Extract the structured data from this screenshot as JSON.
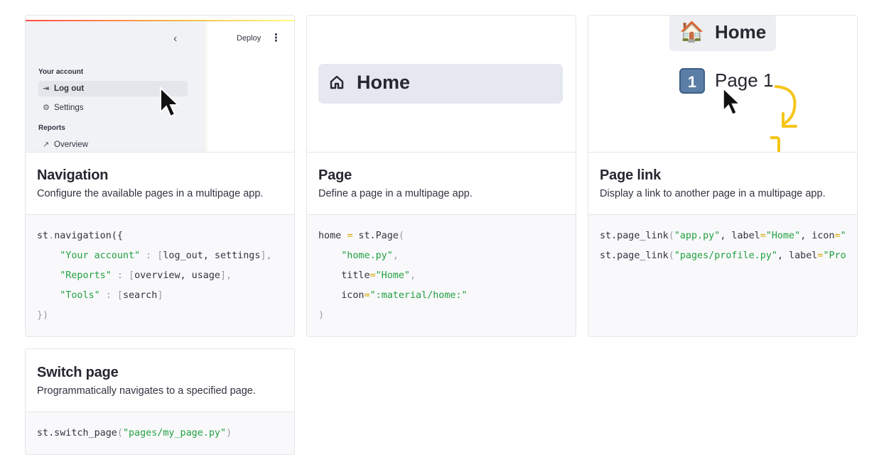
{
  "cards": {
    "navigation": {
      "title": "Navigation",
      "description": "Configure the available pages in a multipage app.",
      "preview": {
        "deploy_label": "Deploy",
        "section_account": "Your account",
        "item_logout": "Log out",
        "item_settings": "Settings",
        "section_reports": "Reports",
        "item_overview": "Overview"
      },
      "code": {
        "l1_a": "st",
        "l1_b": ".",
        "l1_c": "navigation({",
        "l2_key": "\"Your account\"",
        "l2_sep": " : [",
        "l2_val": "log_out, settings",
        "l2_end": "],",
        "l3_key": "\"Reports\"",
        "l3_sep": " : [",
        "l3_val": "overview, usage",
        "l3_end": "],",
        "l4_key": "\"Tools\"",
        "l4_sep": " : [",
        "l4_val": "search",
        "l4_end": "]",
        "l5": "})"
      }
    },
    "page": {
      "title": "Page",
      "description": "Define a page in a multipage app.",
      "preview": {
        "home_label": "Home"
      },
      "code": {
        "l1_a": "home ",
        "l1_eq": "=",
        "l1_b": " st.Page",
        "l1_paren": "(",
        "l2": "\"home.py\"",
        "l2_c": ",",
        "l3_a": "title",
        "l3_eq": "=",
        "l3_s": "\"Home\"",
        "l3_c": ",",
        "l4_a": "icon",
        "l4_eq": "=",
        "l4_s": "\":material/home:\"",
        "l5": ")"
      }
    },
    "page_link": {
      "title": "Page link",
      "description": "Display a link to another page in a multipage app.",
      "preview": {
        "home_emoji": "🏠",
        "home_label": "Home",
        "page_badge": "1",
        "page_label": "Page 1"
      },
      "code": {
        "l1_a": "st.page_link",
        "l1_p": "(",
        "l1_s1": "\"app.py\"",
        "l1_c1": ", label",
        "l1_eq1": "=",
        "l1_s2": "\"Home\"",
        "l1_c2": ", icon",
        "l1_eq2": "=",
        "l1_s3": "\"",
        "l2_a": "st.page_link",
        "l2_p": "(",
        "l2_s1": "\"pages/profile.py\"",
        "l2_c1": ", label",
        "l2_eq1": "=",
        "l2_s2": "\"Pro"
      }
    },
    "switch_page": {
      "title": "Switch page",
      "description": "Programmatically navigates to a specified page.",
      "code": {
        "l1_a": "st.switch_page",
        "l1_p": "(",
        "l1_s": "\"pages/my_page.py\"",
        "l1_e": ")"
      }
    }
  },
  "colors": {
    "string": "#21a040",
    "punct": "#9a9ca4",
    "operator": "#d4a500",
    "accent_arrow": "#f5c518"
  },
  "icons": [
    "chevron-left-icon",
    "kebab-menu-icon",
    "logout-icon",
    "gear-icon",
    "chart-line-icon",
    "home-outline-icon",
    "house-emoji-icon",
    "cursor-icon",
    "curved-arrow-icon"
  ]
}
